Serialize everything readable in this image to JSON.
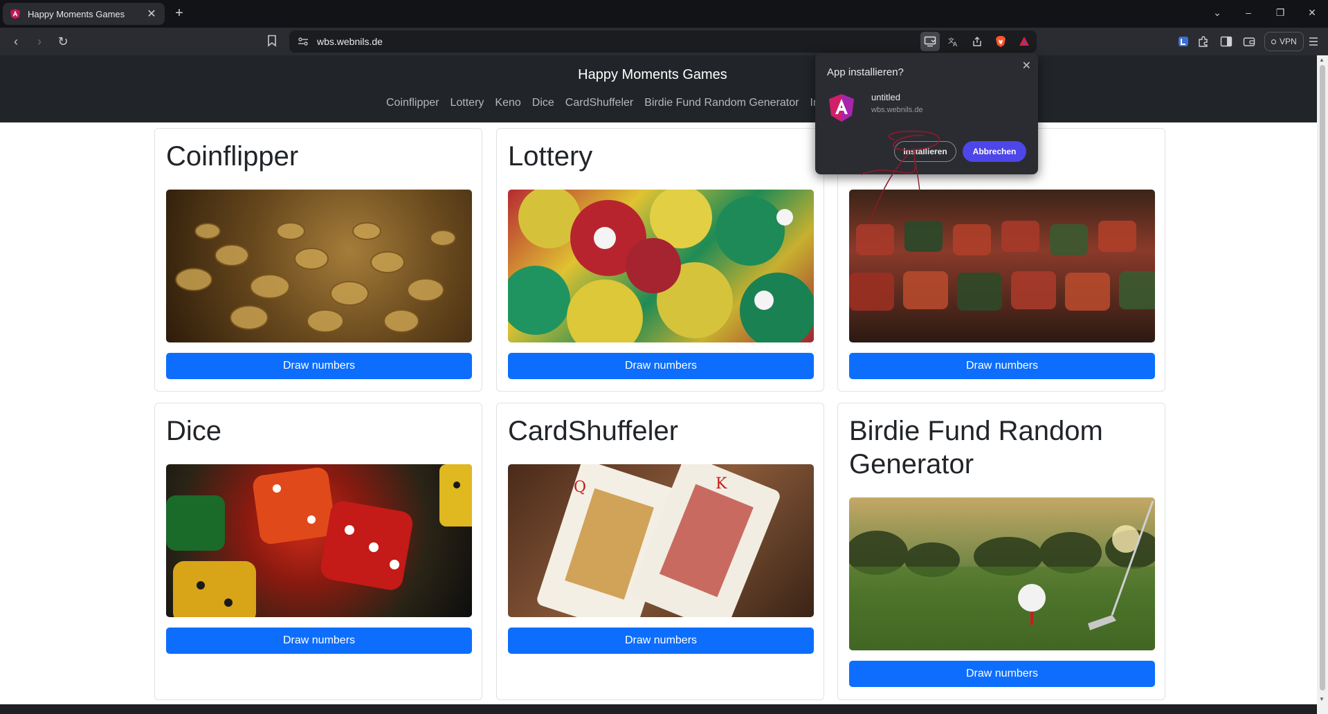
{
  "browser": {
    "tab": {
      "title": "Happy Moments Games"
    },
    "url": "wbs.webnils.de",
    "vpn_label": "VPN"
  },
  "site": {
    "title": "Happy Moments Games",
    "nav": [
      "Coinflipper",
      "Lottery",
      "Keno",
      "Dice",
      "CardShuffeler",
      "Birdie Fund Random Generator",
      "Im"
    ]
  },
  "cards": [
    {
      "title": "Coinflipper",
      "image": "coins",
      "button": "Draw numbers"
    },
    {
      "title": "Lottery",
      "image": "lottery-balls",
      "button": "Draw numbers"
    },
    {
      "title": "",
      "image": "keno-dice",
      "button": "Draw numbers"
    },
    {
      "title": "Dice",
      "image": "dice",
      "button": "Draw numbers"
    },
    {
      "title": "CardShuffeler",
      "image": "playing-cards",
      "button": "Draw numbers"
    },
    {
      "title": "Birdie Fund Random Generator",
      "image": "golf-ball",
      "button": "Draw numbers"
    }
  ],
  "install_popup": {
    "title": "App installieren?",
    "app_name": "untitled",
    "app_url": "wbs.webnils.de",
    "install_label": "Installieren",
    "cancel_label": "Abbrechen"
  },
  "colors": {
    "header_bg": "#212529",
    "primary_button": "#0d6efd",
    "popup_cancel": "#4d46e8",
    "annotation": "#8b1a2a"
  }
}
